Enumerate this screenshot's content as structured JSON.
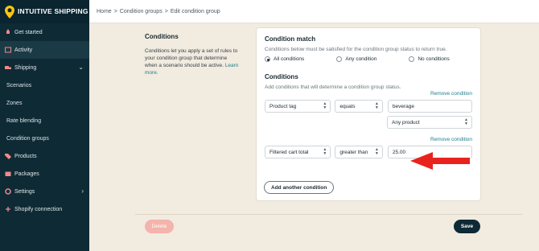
{
  "brand": {
    "name": "INTUITIVE SHIPPING"
  },
  "sidebar": {
    "items": [
      {
        "label": "Get started",
        "icon": "rocket-icon"
      },
      {
        "label": "Activity",
        "icon": "activity-icon"
      },
      {
        "label": "Shipping",
        "icon": "truck-icon"
      },
      {
        "label": "Scenarios"
      },
      {
        "label": "Zones"
      },
      {
        "label": "Rate blending"
      },
      {
        "label": "Condition groups"
      },
      {
        "label": "Products",
        "icon": "tag-icon"
      },
      {
        "label": "Packages",
        "icon": "box-icon"
      },
      {
        "label": "Settings",
        "icon": "gear-icon"
      },
      {
        "label": "Shopify connection",
        "icon": "link-icon"
      }
    ]
  },
  "breadcrumb": {
    "home": "Home",
    "groups": "Condition groups",
    "current": "Edit condition group",
    "sep": ">"
  },
  "intro": {
    "title": "Conditions",
    "body": "Conditions let you apply a set of rules to your condition group that determine when a scenario should be active.",
    "link": "Learn more."
  },
  "match": {
    "title": "Condition match",
    "hint": "Conditions below must be satisfied for the condition group status to return true.",
    "options": [
      "All conditions",
      "Any condition",
      "No conditions"
    ],
    "selected": "All conditions"
  },
  "conditions": {
    "title": "Conditions",
    "hint": "Add conditions that will determine a condition group status.",
    "remove_label": "Remove condition",
    "rows": [
      {
        "field": "Product tag",
        "operator": "equals",
        "value": "beverage",
        "extra": "Any product"
      },
      {
        "field": "Filtered cart total",
        "operator": "greater than",
        "value": "25.00"
      }
    ],
    "add_label": "Add another condition"
  },
  "footer": {
    "delete_label": "Delete",
    "save_label": "Save"
  },
  "colors": {
    "sidebar": "#0e2a35",
    "accent": "#1f7e8a",
    "delete": "#f4b3ab",
    "annotation": "#e8231d"
  }
}
